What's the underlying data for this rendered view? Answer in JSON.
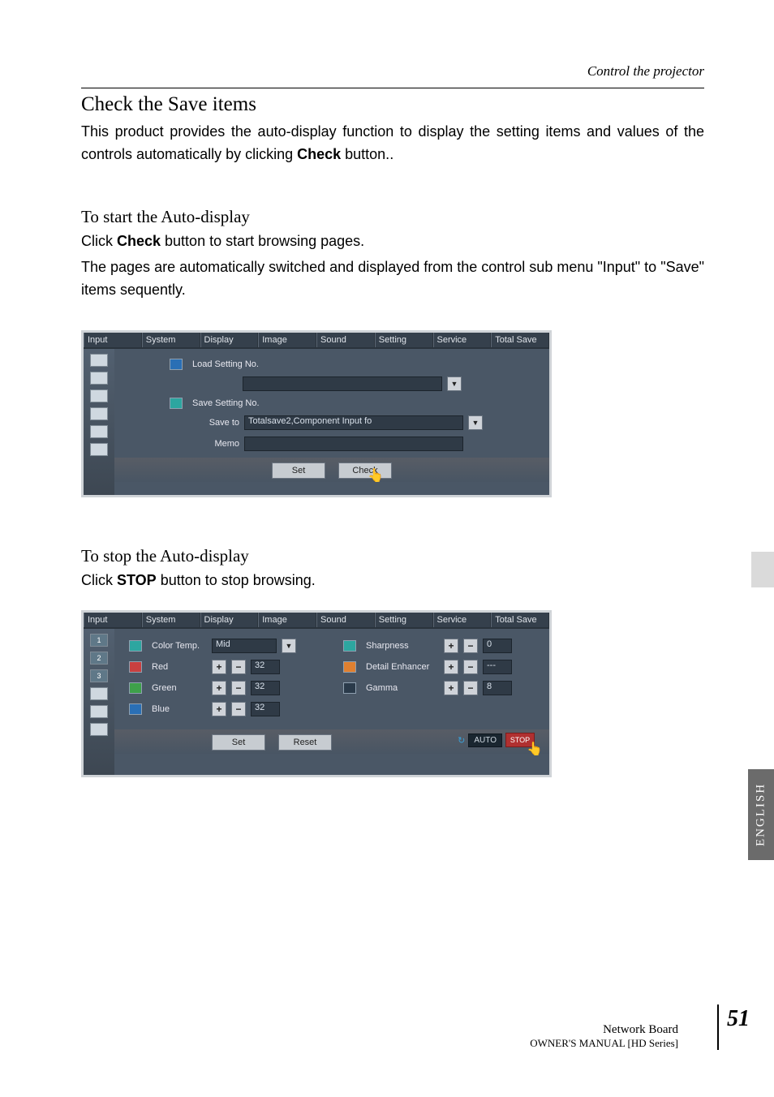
{
  "header": {
    "section": "Control the projector"
  },
  "section1": {
    "title": "Check the Save items",
    "para": "This product provides the auto-display function to display the setting items and values of the controls automatically by clicking ",
    "bold": "Check",
    "para_tail": " button.."
  },
  "section2": {
    "title": "To start the Auto-display",
    "line1a": "Click ",
    "line1b": "Check",
    "line1c": " button to start browsing pages.",
    "line2": "The pages are automatically switched and displayed from the control sub menu \"Input\" to \"Save\" items sequently."
  },
  "tabs": [
    "Input",
    "System",
    "Display",
    "Image",
    "Sound",
    "Setting",
    "Service",
    "Total Save"
  ],
  "osd1": {
    "load_label": "Load Setting No.",
    "save_label": "Save Setting No.",
    "saveto_label": "Save to",
    "saveto_value": "Totalsave2,Component Input fo",
    "memo_label": "Memo",
    "btn_set": "Set",
    "btn_check": "Check"
  },
  "section3": {
    "title": "To stop the Auto-display",
    "line1a": "Click ",
    "line1b": "STOP",
    "line1c": " button to stop browsing."
  },
  "osd2": {
    "colortemp_label": "Color Temp.",
    "colortemp_value": "Mid",
    "red_label": "Red",
    "red_value": "32",
    "green_label": "Green",
    "green_value": "32",
    "blue_label": "Blue",
    "blue_value": "32",
    "sharp_label": "Sharpness",
    "sharp_value": "0",
    "detail_label": "Detail Enhancer",
    "detail_value": "---",
    "gamma_label": "Gamma",
    "gamma_value": "8",
    "btn_set": "Set",
    "btn_reset": "Reset",
    "auto_label": "AUTO",
    "stop_label": "STOP",
    "side_nums": [
      "1",
      "2",
      "3"
    ]
  },
  "footer": {
    "line1": "Network Board",
    "line2": "OWNER'S MANUAL [HD Series]",
    "page": "51",
    "lang": "ENGLISH"
  }
}
